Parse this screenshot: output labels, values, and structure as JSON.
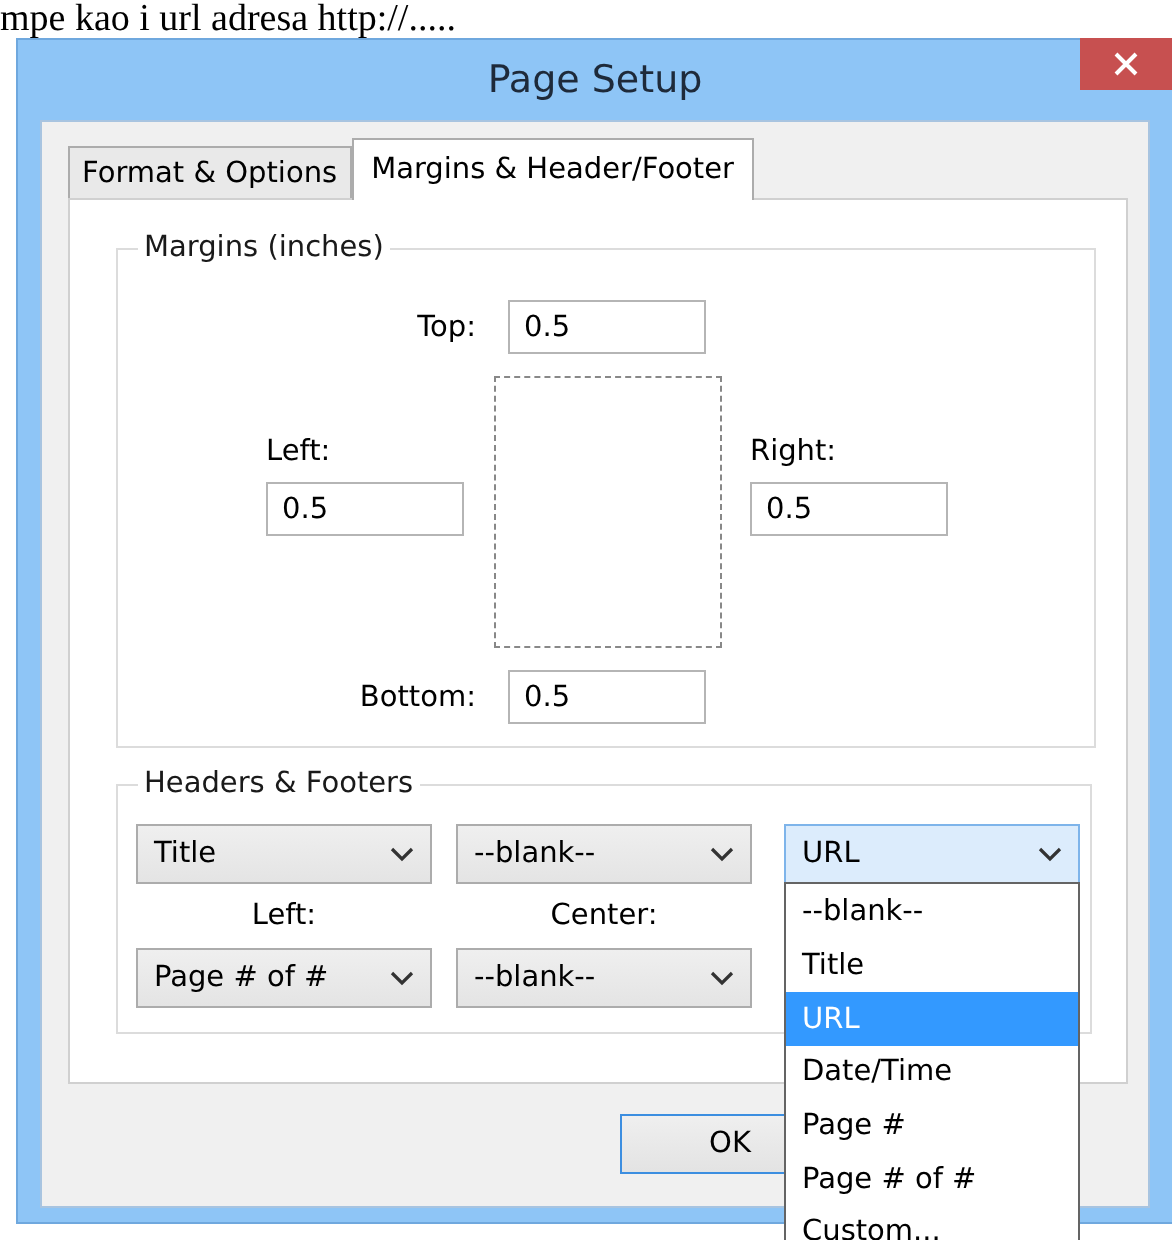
{
  "background_text": "mpe kao i url adresa http://.....",
  "window": {
    "title": "Page Setup"
  },
  "tabs": [
    {
      "label": "Format & Options",
      "selected": false
    },
    {
      "label": "Margins & Header/Footer",
      "selected": true
    }
  ],
  "margins": {
    "title": "Margins (inches)",
    "top": {
      "label": "Top:",
      "value": "0.5"
    },
    "left": {
      "label": "Left:",
      "value": "0.5"
    },
    "right": {
      "label": "Right:",
      "value": "0.5"
    },
    "bottom": {
      "label": "Bottom:",
      "value": "0.5"
    }
  },
  "headers_footers": {
    "title": "Headers & Footers",
    "header": [
      {
        "value": "Title",
        "open": false
      },
      {
        "value": "--blank--",
        "open": false
      },
      {
        "value": "URL",
        "open": true
      }
    ],
    "labels": [
      "Left:",
      "Center:"
    ],
    "footer": [
      {
        "value": "Page # of #",
        "open": false
      },
      {
        "value": "--blank--",
        "open": false
      }
    ],
    "options": [
      {
        "label": "--blank--",
        "selected": false
      },
      {
        "label": "Title",
        "selected": false
      },
      {
        "label": "URL",
        "selected": true
      },
      {
        "label": "Date/Time",
        "selected": false
      },
      {
        "label": "Page #",
        "selected": false
      },
      {
        "label": "Page # of #",
        "selected": false
      },
      {
        "label": "Custom...",
        "selected": false
      }
    ]
  },
  "buttons": [
    {
      "label": "OK"
    }
  ]
}
